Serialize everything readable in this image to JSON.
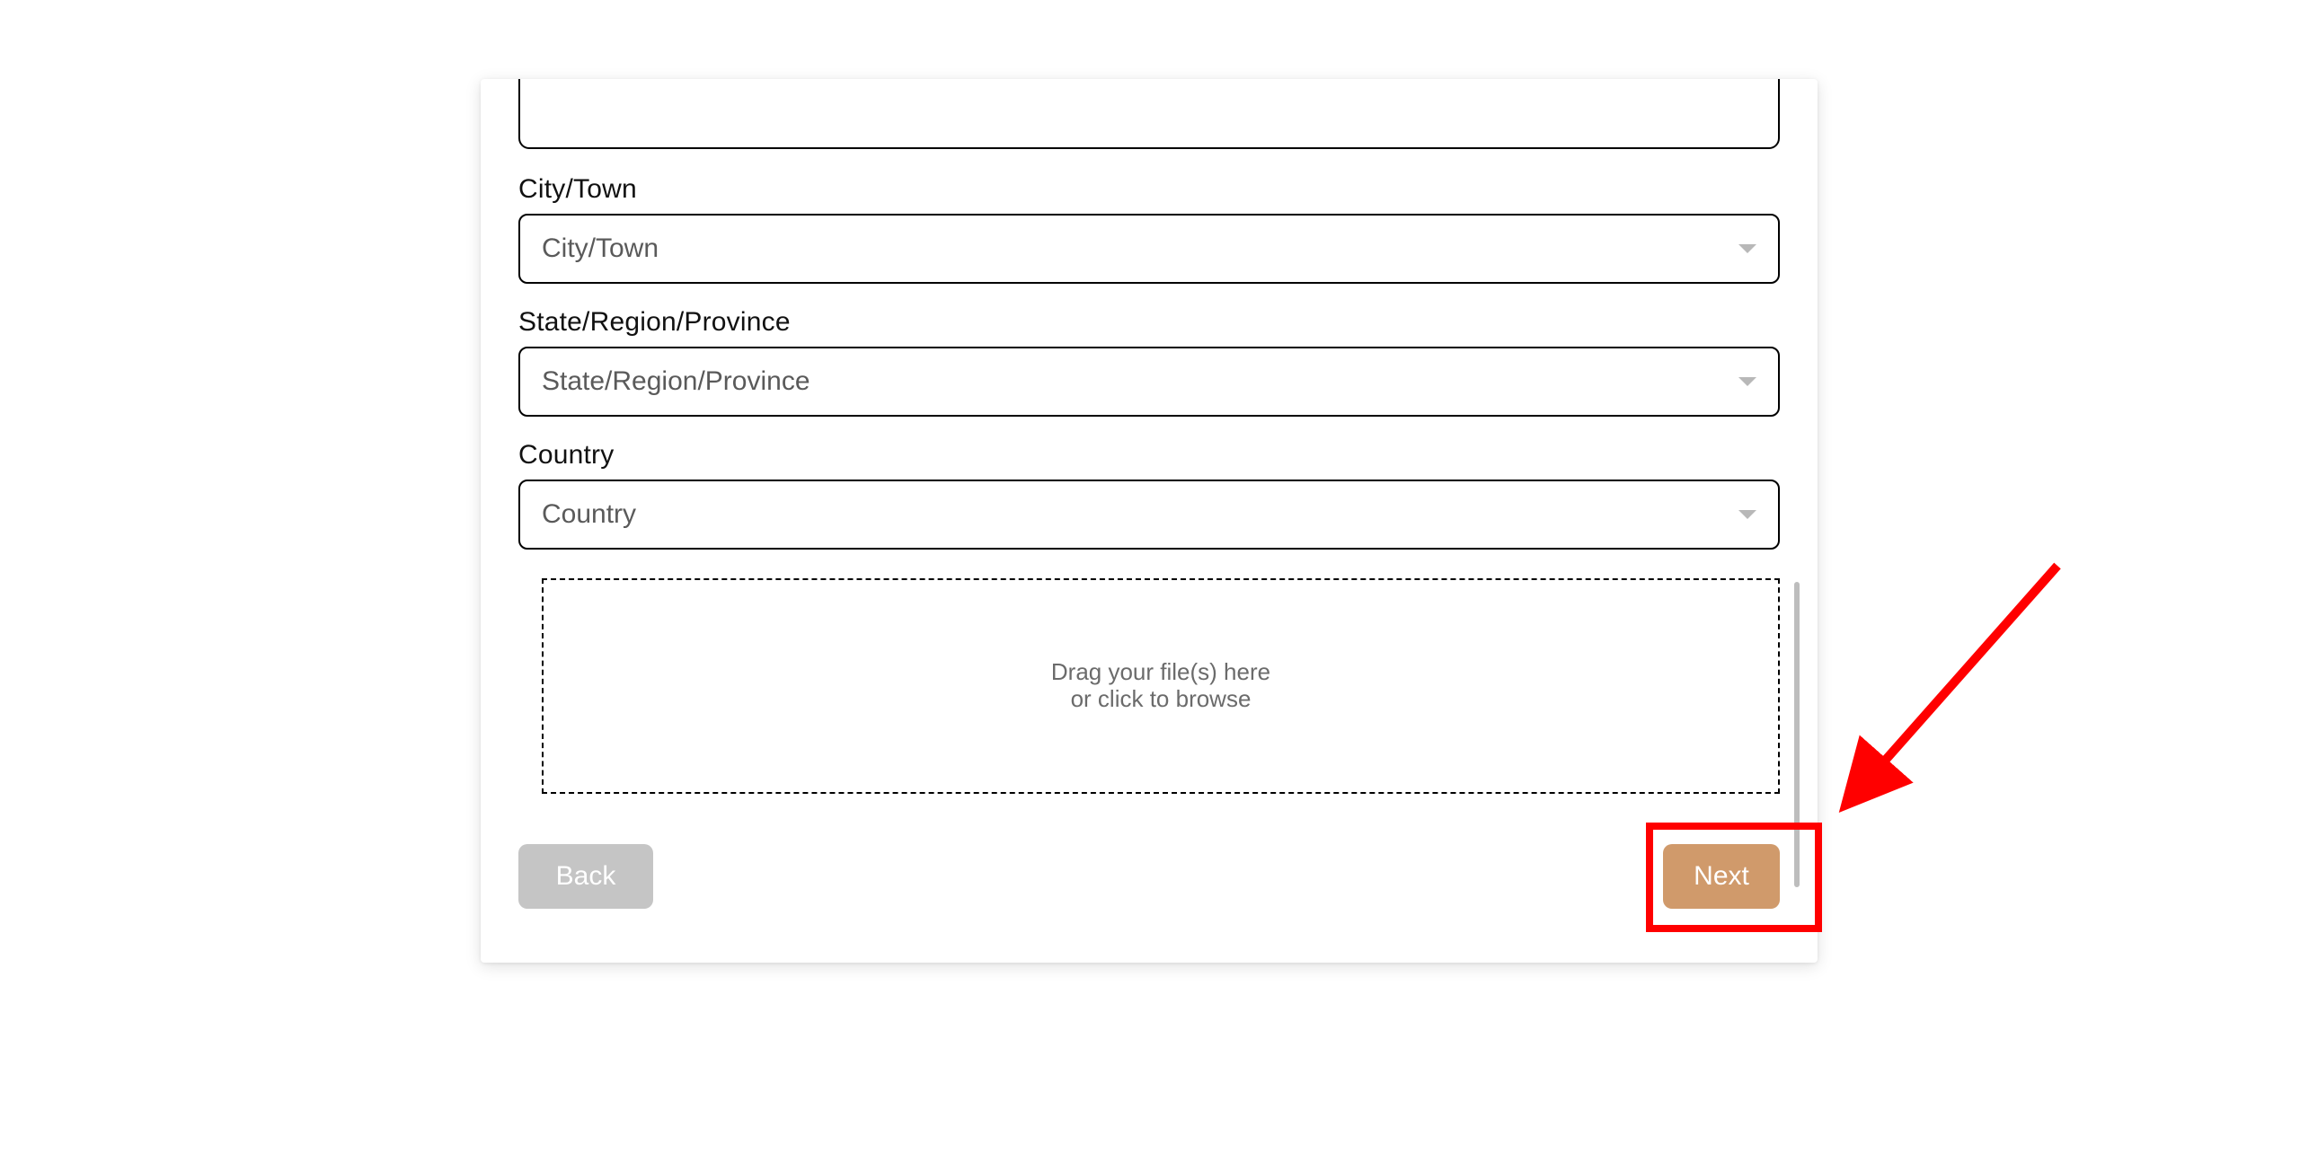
{
  "form": {
    "city": {
      "label": "City/Town",
      "placeholder": "City/Town"
    },
    "state": {
      "label": "State/Region/Province",
      "placeholder": "State/Region/Province"
    },
    "country": {
      "label": "Country",
      "placeholder": "Country"
    },
    "dropzone": {
      "line1": "Drag your file(s) here",
      "line2": "or click to browse"
    }
  },
  "buttons": {
    "back": "Back",
    "next": "Next"
  },
  "annotation": {
    "highlight_target": "next-button"
  }
}
